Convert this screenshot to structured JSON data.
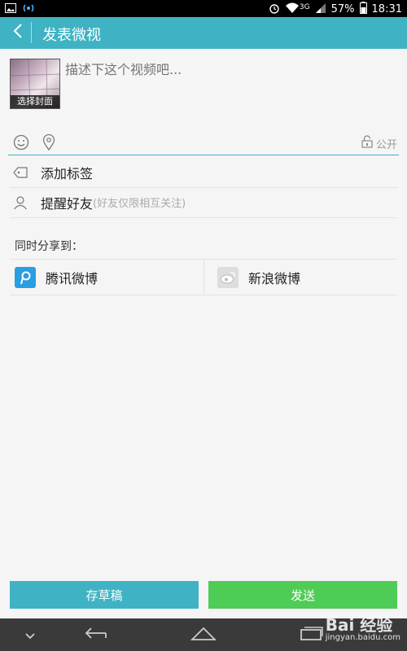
{
  "status_bar": {
    "battery": "57%",
    "time": "18:31",
    "network": "3G",
    "icons": [
      "image-icon",
      "signal-broadcast-icon",
      "alarm-icon",
      "wifi-icon",
      "cell-signal-icon",
      "battery-icon"
    ]
  },
  "app_bar": {
    "title": "发表微视",
    "back_icon": "chevron-left-icon",
    "color": "#3fb3c4"
  },
  "compose": {
    "cover_label": "选择封面",
    "placeholder": "描述下这个视频吧..."
  },
  "toolbar": {
    "emoji_icon": "smile-icon",
    "location_icon": "location-pin-icon",
    "privacy_icon": "lock-icon",
    "privacy_label": "公开"
  },
  "options": {
    "add_tag": "添加标签",
    "remind_label": "提醒好友",
    "remind_hint": "(好友仅限相互关注)"
  },
  "share": {
    "title": "同时分享到：",
    "targets": [
      {
        "label": "腾讯微博",
        "icon": "tencent-weibo-icon"
      },
      {
        "label": "新浪微博",
        "icon": "sina-weibo-icon"
      }
    ]
  },
  "actions": {
    "draft_label": "存草稿",
    "send_label": "发送",
    "draft_color": "#3fb3c4",
    "send_color": "#4fcc55"
  },
  "nav_bar": {
    "icons": [
      "chevron-down-icon",
      "back-arrow-icon",
      "home-icon",
      "recent-apps-icon"
    ]
  },
  "watermark": {
    "text": "Bai 经验",
    "url": "jingyan.baidu.com"
  }
}
